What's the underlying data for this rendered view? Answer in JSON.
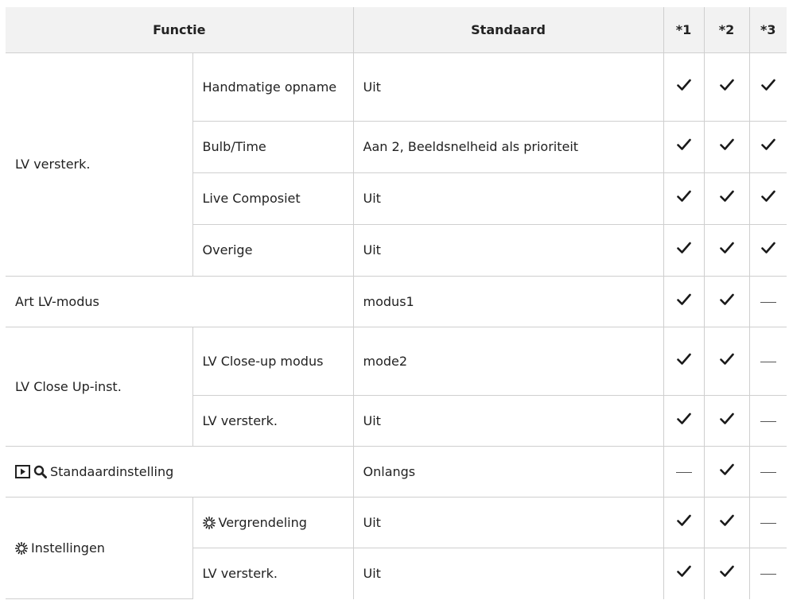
{
  "header": {
    "functie": "Functie",
    "standaard": "Standaard",
    "col1": "*1",
    "col2": "*2",
    "col3": "*3"
  },
  "rows": {
    "lv_versterk": {
      "label": "LV versterk.",
      "sub": [
        {
          "label": "Handmatige opname",
          "value": "Uit",
          "marks": [
            "check",
            "check",
            "check"
          ]
        },
        {
          "label": "Bulb/Time",
          "value": "Aan 2, Beeldsnelheid als prioriteit",
          "marks": [
            "check",
            "check",
            "check"
          ]
        },
        {
          "label": "Live Composiet",
          "value": "Uit",
          "marks": [
            "check",
            "check",
            "check"
          ]
        },
        {
          "label": "Overige",
          "value": "Uit",
          "marks": [
            "check",
            "check",
            "check"
          ]
        }
      ]
    },
    "art_lv": {
      "label": "Art LV-modus",
      "value": "modus1",
      "marks": [
        "check",
        "check",
        "dash"
      ]
    },
    "lv_closeup": {
      "label": "LV Close Up-inst.",
      "sub": [
        {
          "label": "LV Close-up modus",
          "value": "mode2",
          "marks": [
            "check",
            "check",
            "dash"
          ]
        },
        {
          "label": "LV versterk.",
          "value": "Uit",
          "marks": [
            "check",
            "check",
            "dash"
          ]
        }
      ]
    },
    "playback": {
      "label": "Standaardinstelling",
      "icons": [
        "playback-icon",
        "magnifier-icon"
      ],
      "value": "Onlangs",
      "marks": [
        "dash",
        "check",
        "dash"
      ]
    },
    "instellingen": {
      "label": "Instellingen",
      "icon": "dial-icon",
      "sub": [
        {
          "label": "Vergrendeling",
          "icon": "dial-icon",
          "value": "Uit",
          "marks": [
            "check",
            "check",
            "dash"
          ]
        },
        {
          "label": "LV versterk.",
          "value": "Uit",
          "marks": [
            "check",
            "check",
            "dash"
          ]
        }
      ]
    }
  }
}
